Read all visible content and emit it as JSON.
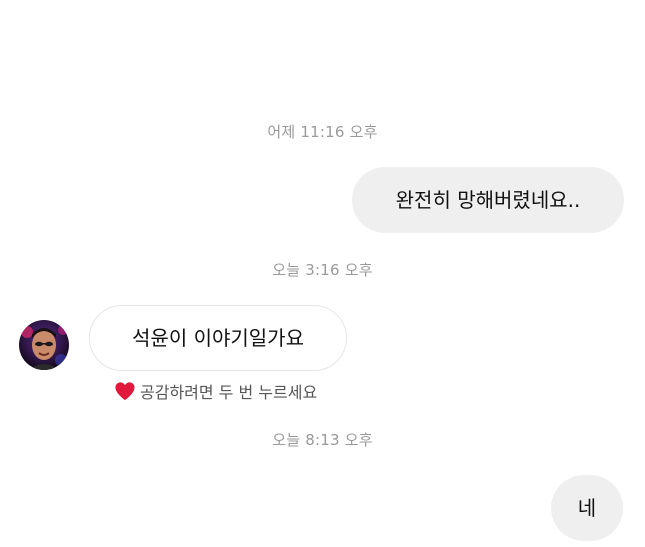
{
  "conversation": {
    "timestamps": {
      "first": "어제 11:16 오후",
      "second": "오늘 3:16 오후",
      "third": "오늘 8:13 오후"
    },
    "messages": {
      "sent_1": "완전히 망해버렸네요..",
      "received_1": "석윤이 이야기일가요",
      "sent_2": "네"
    },
    "react_hint": "공감하려면 두 번 누르세요",
    "colors": {
      "sent_bubble": "#efefef",
      "received_border": "#e6e6e6",
      "timestamp_text": "#9a9a9a",
      "heart": "#e0193c"
    },
    "icons": {
      "heart": "heart-icon",
      "avatar": "avatar"
    }
  }
}
